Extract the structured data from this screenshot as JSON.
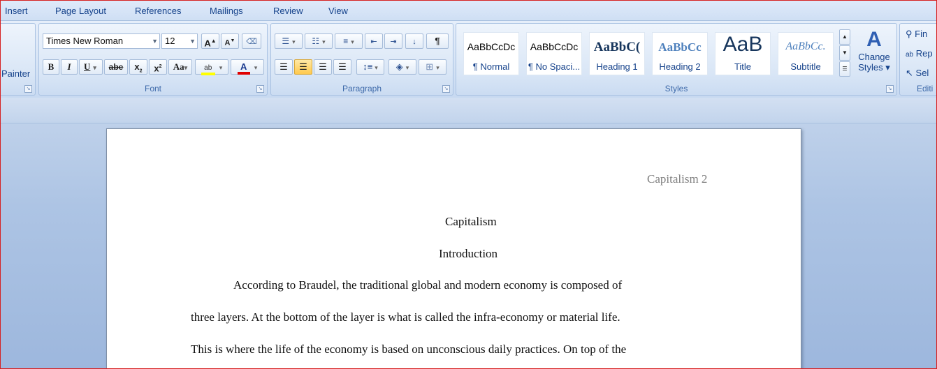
{
  "tabs": [
    "Insert",
    "Page Layout",
    "References",
    "Mailings",
    "Review",
    "View"
  ],
  "clipboard": {
    "painter_label": "Painter"
  },
  "font": {
    "family": "Times New Roman",
    "size": "12",
    "group_label": "Font",
    "grow_label": "A",
    "shrink_label": "A",
    "bold": "B",
    "italic": "I",
    "underline": "U",
    "strike": "abe",
    "subscript": "x",
    "superscript": "x",
    "change_case": "Aa",
    "highlight_label": "ab",
    "font_color_label": "A"
  },
  "paragraph": {
    "group_label": "Paragraph",
    "pilcrow": "¶"
  },
  "styles": {
    "group_label": "Styles",
    "items": [
      {
        "sample": "AaBbCcDc",
        "name": "¶ Normal"
      },
      {
        "sample": "AaBbCcDc",
        "name": "¶ No Spaci..."
      },
      {
        "sample": "AaBbC(",
        "name": "Heading 1"
      },
      {
        "sample": "AaBbCc",
        "name": "Heading 2"
      },
      {
        "sample": "AaB",
        "name": "Title"
      },
      {
        "sample": "AaBbCc.",
        "name": "Subtitle"
      }
    ],
    "change_styles_line1": "Change",
    "change_styles_line2": "Styles ▾"
  },
  "editing": {
    "find": "Fin",
    "replace": "Rep",
    "select": "Sel",
    "group_label": "Editi"
  },
  "document": {
    "header": "Capitalism 2",
    "title": "Capitalism",
    "heading": "Introduction",
    "lines": [
      "According to Braudel, the traditional global and modern economy is composed of",
      "three layers.  At the bottom of the layer is what is called the infra-economy  or material life.",
      "This is where the life of the economy is based on unconscious daily practices.  On top of the"
    ]
  },
  "colors": {
    "highlight": "#ffff00",
    "font_color": "#e00000",
    "accent": "#15428b"
  }
}
